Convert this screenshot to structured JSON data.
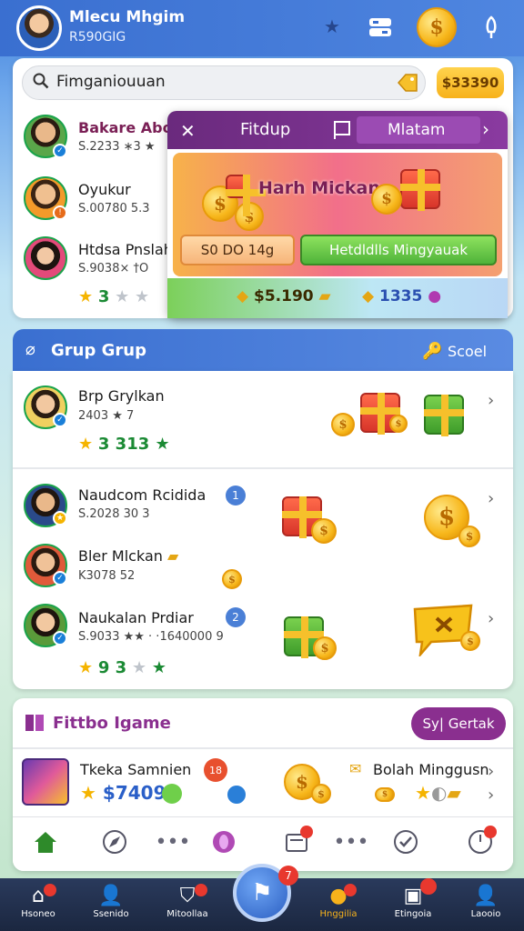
{
  "header": {
    "name": "Mlecu Mhgim",
    "sub": "R590GIG"
  },
  "search": {
    "placeholder": "Fimganiouuan"
  },
  "balance": "$33390",
  "friends": [
    {
      "name": "Bakare Abon",
      "sub": "S.2233 ∗3 ★"
    },
    {
      "name": "Oyukur",
      "sub": "S.00780 5.3"
    },
    {
      "name": "Htdsa Pnslah",
      "sub": "S.9038× †O"
    }
  ],
  "friends_rating": "3",
  "popup": {
    "title": "Fitdup",
    "tab": "Mlatam",
    "banner_title": "Harh Mickan",
    "btn_left": "S0 DO 14g",
    "btn_right": "Hetdldlls Mingyauak",
    "foot_left": "$5.190",
    "foot_right": "1335"
  },
  "group": {
    "title": "Grup Grup",
    "action": "Scoel",
    "rows": [
      {
        "name": "Brp Grylkan",
        "sub": "2403 ★ 7",
        "rating": "3 313 ★"
      },
      {
        "name": "Naudcom Rcidida",
        "sub": "S.2028 30 3",
        "badge": "1"
      },
      {
        "name": "Bler Mlckan",
        "sub": "K3078 52"
      },
      {
        "name": "Naukalan Prdiar",
        "sub": "S.9033 ★★ · ·1640000 9",
        "badge": "2",
        "rating": "9 3"
      }
    ]
  },
  "feature": {
    "title": "Fittbo Igame",
    "button": "Sy| Gertak",
    "item_name": "Tkeka Samnien",
    "item_price": "$7409",
    "right_label": "Bolah Minggusn"
  },
  "nav": {
    "center_badge": "7",
    "items": [
      {
        "label": "Hsoneo",
        "icon": "home-icon"
      },
      {
        "label": "Ssenido",
        "icon": "friends-icon"
      },
      {
        "label": "Mitoollaa",
        "icon": "shield-icon"
      },
      {
        "label": "Hnggilia",
        "icon": "coin-icon"
      },
      {
        "label": "Etingoia",
        "icon": "inbox-icon"
      },
      {
        "label": "Laooio",
        "icon": "profile-icon"
      }
    ]
  },
  "colors": {
    "accent": "#3a6fd0",
    "purple": "#8a2f8f",
    "gold": "#f7b21b",
    "green": "#1b8a34"
  }
}
